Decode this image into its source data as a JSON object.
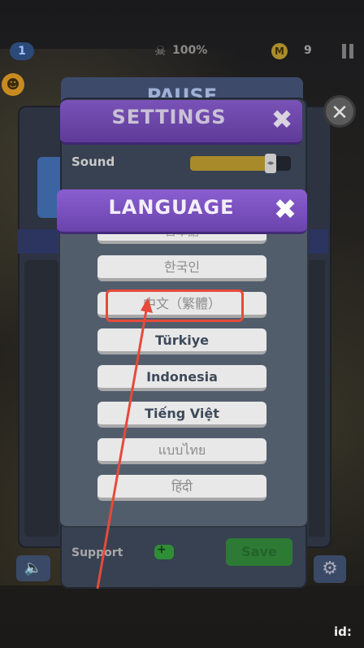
{
  "hud": {
    "level": "1",
    "percent": "100%",
    "coin_symbol": "M",
    "coins": "9"
  },
  "pause": {
    "title": "PAUSE"
  },
  "settings": {
    "title": "SETTINGS",
    "close_symbol": "✖",
    "sound_label": "Sound",
    "sound_level": 0.8,
    "support_label": "Support",
    "save_label": "Save"
  },
  "language": {
    "title": "LANGUAGE",
    "close_symbol": "✖",
    "partial_item": "日本語",
    "items": [
      "한국인",
      "中文（繁體）",
      "Türkiye",
      "Indonesia",
      "Tiếng Việt",
      "แบบไทย",
      "हिंदी"
    ],
    "highlighted_index": 1
  },
  "footer": {
    "id_label": "id:"
  },
  "colors": {
    "settings_header": "#6a46a8",
    "language_header": "#7b52c4",
    "annotation": "#e64a3a",
    "save_green": "#2d7a35"
  },
  "icons": [
    "skull-icon",
    "coin-icon",
    "pause-icon",
    "close-icon",
    "gamepad-icon",
    "speaker-icon",
    "gear-icon"
  ]
}
